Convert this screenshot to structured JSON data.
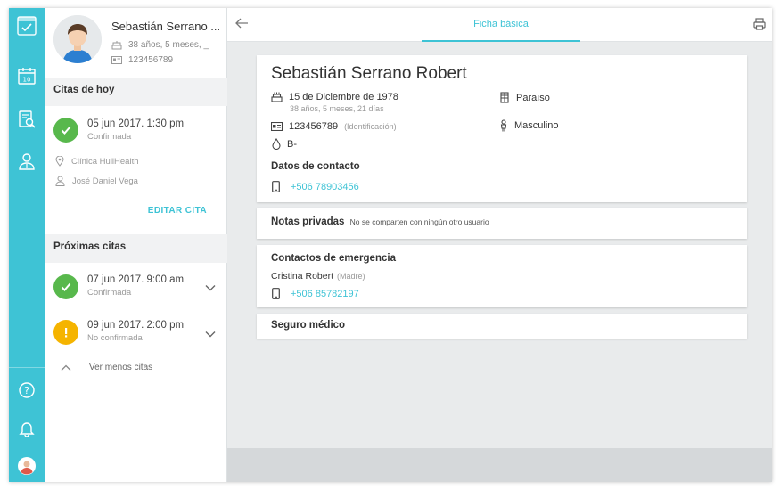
{
  "patient": {
    "short_name": "Sebastián Serrano ...",
    "age_short": "38 años, 5 meses, _",
    "id_number": "123456789"
  },
  "today": {
    "header": "Citas de hoy",
    "appointment": {
      "date": "05 jun 2017. 1:30 pm",
      "status": "Confirmada",
      "clinic": "Clínica HuliHealth",
      "doctor": "José Daniel Vega"
    },
    "edit_label": "EDITAR CITA"
  },
  "upcoming": {
    "header": "Próximas citas",
    "items": [
      {
        "date": "07 jun 2017. 9:00 am",
        "status": "Confirmada"
      },
      {
        "date": "09 jun 2017. 2:00 pm",
        "status": "No confirmada"
      }
    ],
    "less_label": "Ver menos citas"
  },
  "topbar": {
    "tab_label": "Ficha básica"
  },
  "profile": {
    "full_name": "Sebastián Serrano Robert",
    "birth_date": "15 de Diciembre de 1978",
    "age_full": "38 años, 5 meses, 21 días",
    "id_number": "123456789",
    "id_label": "(Identificación)",
    "blood_type": "B-",
    "location": "Paraíso",
    "gender": "Masculino",
    "contact_header": "Datos de contacto",
    "phone": "+506 78903456"
  },
  "private_notes": {
    "title": "Notas privadas",
    "subtitle": "No se comparten con ningún otro usuario"
  },
  "emergency": {
    "title": "Contactos de emergencia",
    "contact_name": "Cristina Robert",
    "relation": "(Madre)",
    "phone": "+506 85782197"
  },
  "insurance": {
    "title": "Seguro médico"
  },
  "colors": {
    "accent": "#3ec3d5",
    "confirmed": "#58b84c",
    "pending": "#f5b400"
  }
}
